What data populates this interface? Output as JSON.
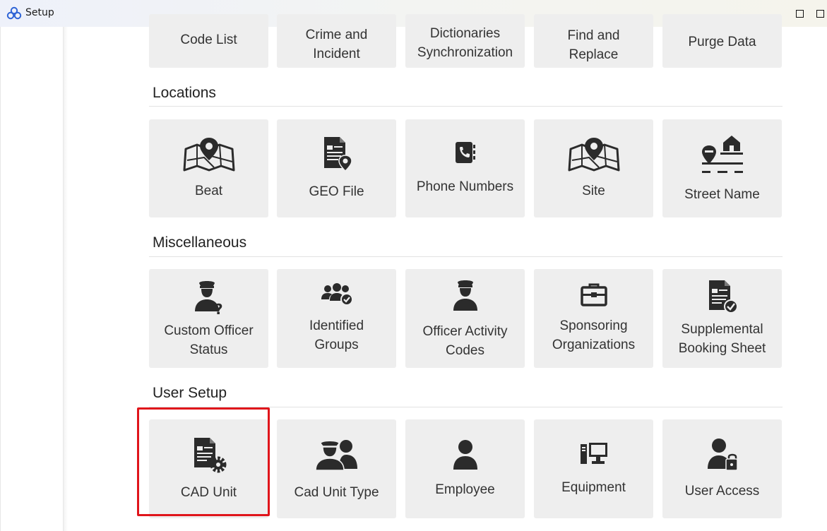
{
  "window": {
    "title": "Setup"
  },
  "sections": {
    "top": {
      "tiles": [
        "Code List",
        "Crime and Incident",
        "Dictionaries Synchronization",
        "Find and Replace",
        "Purge Data"
      ]
    },
    "locations": {
      "title": "Locations",
      "tiles": [
        "Beat",
        "GEO File",
        "Phone Numbers",
        "Site",
        "Street Name"
      ]
    },
    "miscellaneous": {
      "title": "Miscellaneous",
      "tiles": [
        "Custom Officer Status",
        "Identified Groups",
        "Officer Activity Codes",
        "Sponsoring Organizations",
        "Supplemental Booking Sheet"
      ]
    },
    "user_setup": {
      "title": "User Setup",
      "tiles": [
        "CAD Unit",
        "Cad Unit Type",
        "Employee",
        "Equipment",
        "User Access"
      ]
    }
  },
  "icons": {
    "beat": "map-pin-icon",
    "geo_file": "document-pin-icon",
    "phone_numbers": "phone-book-icon",
    "site": "map-pin-icon",
    "street_name": "street-house-icon",
    "custom_officer_status": "officer-question-icon",
    "identified_groups": "group-check-icon",
    "officer_activity_codes": "officer-icon",
    "sponsoring_organizations": "briefcase-icon",
    "supplemental_booking_sheet": "document-check-icon",
    "cad_unit": "document-gear-icon",
    "cad_unit_type": "officers-group-icon",
    "employee": "user-icon",
    "equipment": "computer-icon",
    "user_access": "user-lock-icon"
  },
  "colors": {
    "tile_bg": "#eeeeee",
    "icon": "#2b2b2b",
    "highlight": "#e0151b",
    "text": "#333333"
  }
}
